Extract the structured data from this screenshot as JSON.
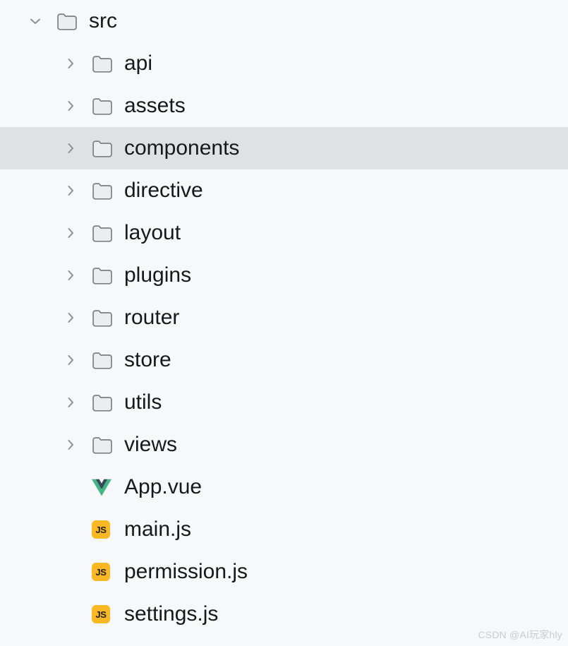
{
  "theme": {
    "background": "#F7F8FA",
    "selection_background": "#DFE1E5",
    "text_color": "#16181C",
    "icon_stroke": "#7C7F86",
    "folder_fill": "#ECEDEF",
    "chevron_color": "#8A8D93",
    "vue_green": "#41B883",
    "vue_dark": "#35495E",
    "js_badge_background": "#FBB724",
    "js_badge_text": "#1E1D1A",
    "watermark_color": "#C9CBCF"
  },
  "tree": {
    "rows": [
      {
        "label": "src",
        "depth": 0,
        "kind": "folder",
        "icon": "folder-icon",
        "twisty": "chevron-down-icon",
        "expanded": true,
        "selected": false
      },
      {
        "label": "api",
        "depth": 1,
        "kind": "folder",
        "icon": "folder-icon",
        "twisty": "chevron-right-icon",
        "expanded": false,
        "selected": false
      },
      {
        "label": "assets",
        "depth": 1,
        "kind": "folder",
        "icon": "folder-icon",
        "twisty": "chevron-right-icon",
        "expanded": false,
        "selected": false
      },
      {
        "label": "components",
        "depth": 1,
        "kind": "folder",
        "icon": "folder-icon",
        "twisty": "chevron-right-icon",
        "expanded": false,
        "selected": true
      },
      {
        "label": "directive",
        "depth": 1,
        "kind": "folder",
        "icon": "folder-icon",
        "twisty": "chevron-right-icon",
        "expanded": false,
        "selected": false
      },
      {
        "label": "layout",
        "depth": 1,
        "kind": "folder",
        "icon": "folder-icon",
        "twisty": "chevron-right-icon",
        "expanded": false,
        "selected": false
      },
      {
        "label": "plugins",
        "depth": 1,
        "kind": "folder",
        "icon": "folder-icon",
        "twisty": "chevron-right-icon",
        "expanded": false,
        "selected": false
      },
      {
        "label": "router",
        "depth": 1,
        "kind": "folder",
        "icon": "folder-icon",
        "twisty": "chevron-right-icon",
        "expanded": false,
        "selected": false
      },
      {
        "label": "store",
        "depth": 1,
        "kind": "folder",
        "icon": "folder-icon",
        "twisty": "chevron-right-icon",
        "expanded": false,
        "selected": false
      },
      {
        "label": "utils",
        "depth": 1,
        "kind": "folder",
        "icon": "folder-icon",
        "twisty": "chevron-right-icon",
        "expanded": false,
        "selected": false
      },
      {
        "label": "views",
        "depth": 1,
        "kind": "folder",
        "icon": "folder-icon",
        "twisty": "chevron-right-icon",
        "expanded": false,
        "selected": false
      },
      {
        "label": "App.vue",
        "depth": 1,
        "kind": "file",
        "icon": "vue-file-icon",
        "twisty": "none",
        "expanded": false,
        "selected": false
      },
      {
        "label": "main.js",
        "depth": 1,
        "kind": "file",
        "icon": "js-file-icon",
        "twisty": "none",
        "expanded": false,
        "selected": false
      },
      {
        "label": "permission.js",
        "depth": 1,
        "kind": "file",
        "icon": "js-file-icon",
        "twisty": "none",
        "expanded": false,
        "selected": false
      },
      {
        "label": "settings.js",
        "depth": 1,
        "kind": "file",
        "icon": "js-file-icon",
        "twisty": "none",
        "expanded": false,
        "selected": false
      }
    ]
  },
  "js_badge_text": "JS",
  "watermark": {
    "text": "CSDN @AI玩家hly"
  }
}
